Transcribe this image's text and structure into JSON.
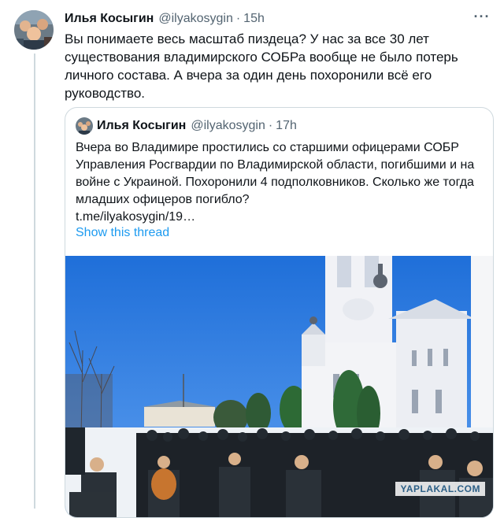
{
  "tweet": {
    "author_name": "Илья Косыгин",
    "author_handle": "@ilyakosygin",
    "separator": "·",
    "time": "15h",
    "text": "Вы понимаете весь масштаб пиздеца? У нас за все 30 лет существования владимирского СОБРа вообще не было потерь личного состава. А вчера за один день похоронили всё его руководство."
  },
  "quoted_tweet": {
    "author_name": "Илья Косыгин",
    "author_handle": "@ilyakosygin",
    "separator": "·",
    "time": "17h",
    "text": "Вчера во Владимире простились со старшими офицерами СОБР Управления Росгвардии по Владимирской области, погибшими и на войне с Украиной. Похоронили 4 подполковников. Сколько же тогда младших офицеров погибло?",
    "link": "t.me/ilyakosygin/19…",
    "show_thread": "Show this thread"
  },
  "photo": {
    "watermark": "YAPLAKAL.COM"
  },
  "colors": {
    "link": "#1d9bf0",
    "secondary_text": "#536471",
    "border": "#cfd9de",
    "sky": "#2f7fe0"
  },
  "icons": {
    "more": "more-options-icon"
  }
}
